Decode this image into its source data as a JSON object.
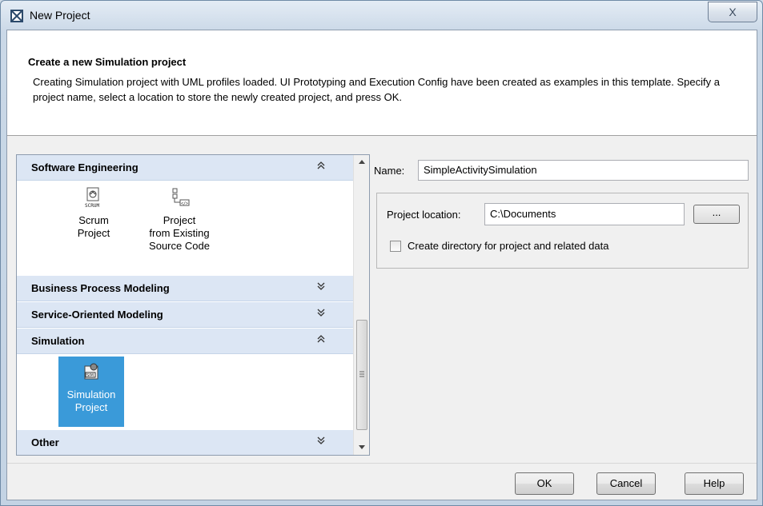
{
  "window": {
    "title": "New Project",
    "close_glyph": "X"
  },
  "header": {
    "title": "Create a new Simulation project",
    "description": "Creating Simulation project with UML profiles loaded. UI Prototyping and Execution Config have been created as examples in this template. Specify a project name, select a location to store the newly created project, and press OK."
  },
  "categories": [
    {
      "label": "Software Engineering",
      "state": "expanded",
      "toggle_glyph": "≈",
      "items": [
        {
          "label": "Scrum\nProject",
          "icon": "scrum-project-icon"
        },
        {
          "label": "Project\nfrom Existing\nSource Code",
          "icon": "source-code-project-icon"
        }
      ]
    },
    {
      "label": "Business Process Modeling",
      "state": "collapsed",
      "toggle_glyph": "≈"
    },
    {
      "label": "Service-Oriented Modeling",
      "state": "collapsed",
      "toggle_glyph": "≈"
    },
    {
      "label": "Simulation",
      "state": "expanded",
      "toggle_glyph": "≈",
      "items": [
        {
          "label": "Simulation\nProject",
          "icon": "simulation-project-icon",
          "selected": true
        }
      ]
    },
    {
      "label": "Other",
      "state": "collapsed",
      "toggle_glyph": "≈"
    }
  ],
  "form": {
    "name_label": "Name:",
    "name_value": "SimpleActivitySimulation",
    "location_label": "Project location:",
    "location_value": "C:\\Documents",
    "browse_label": "...",
    "create_dir_label": "Create directory for project and related data",
    "create_dir_checked": false
  },
  "buttons": {
    "ok": "OK",
    "cancel": "Cancel",
    "help": "Help"
  },
  "colors": {
    "selection": "#3a9ad9",
    "category_header": "#dce6f4",
    "title_bar": "#cad8e7"
  }
}
